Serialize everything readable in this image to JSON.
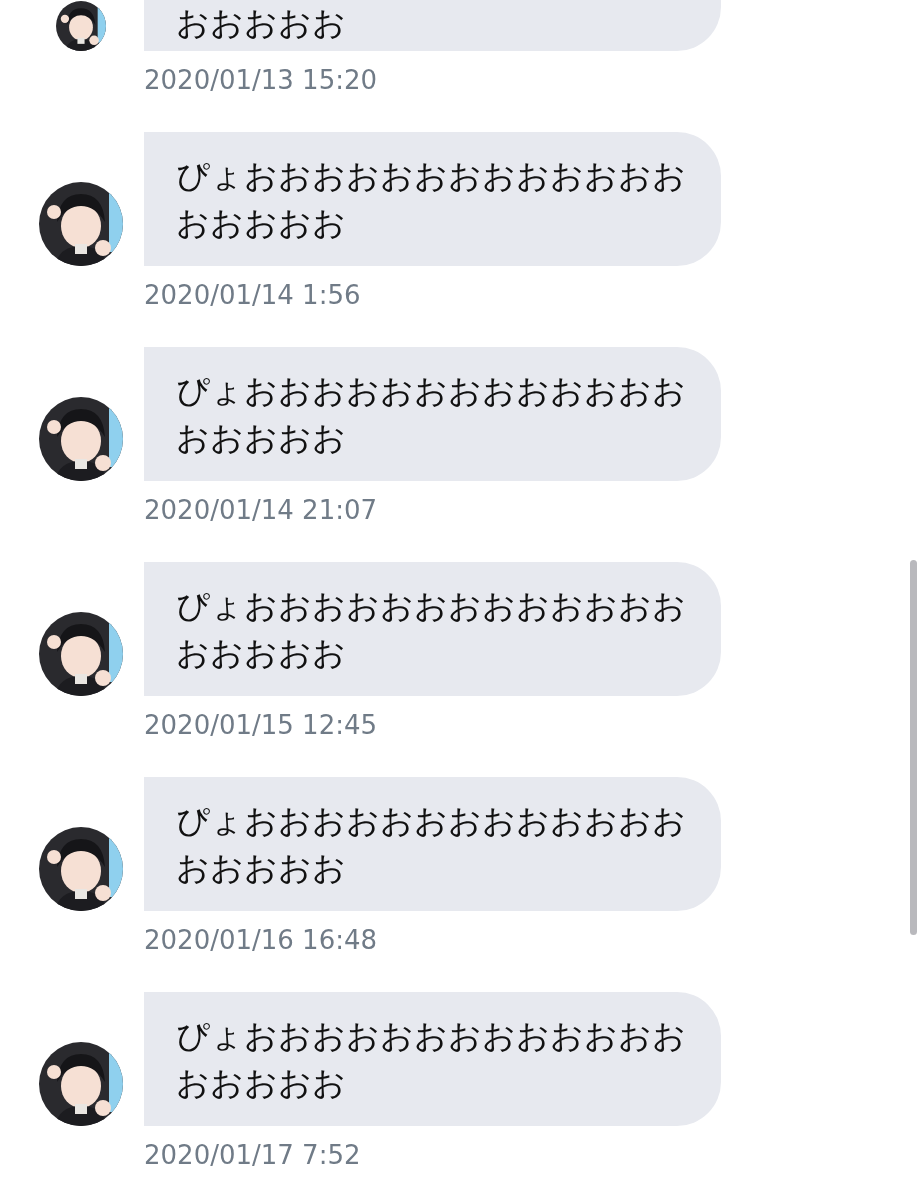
{
  "messages": [
    {
      "text": "おおおおお",
      "time": "2020/01/13 15:20"
    },
    {
      "text": "ぴょおおおおおおおおおおおおおおおおおお",
      "time": "2020/01/14 1:56"
    },
    {
      "text": "ぴょおおおおおおおおおおおおおおおおおお",
      "time": "2020/01/14 21:07"
    },
    {
      "text": "ぴょおおおおおおおおおおおおおおおおおお",
      "time": "2020/01/15 12:45"
    },
    {
      "text": "ぴょおおおおおおおおおおおおおおおおおお",
      "time": "2020/01/16 16:48"
    },
    {
      "text": "ぴょおおおおおおおおおおおおおおおおおお",
      "time": "2020/01/17 7:52"
    }
  ]
}
